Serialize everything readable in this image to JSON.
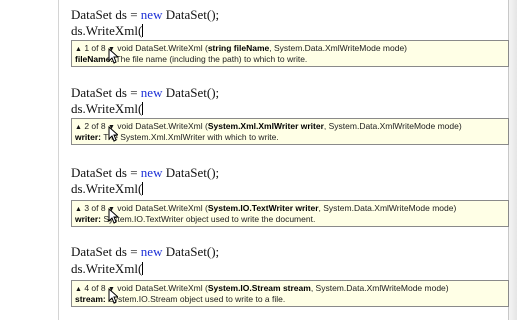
{
  "blocks": [
    {
      "line1_a": "DataSet ds = ",
      "line1_kw": "new",
      "line1_b": " DataSet();",
      "line2": "ds.WriteXml(",
      "tip": {
        "counter": "1 of 8",
        "sig_prefix": "void DataSet.WriteXml (",
        "param_bold": "string fileName",
        "sig_suffix": ", System.Data.XmlWriteMode mode)",
        "param_name": "fileName:",
        "param_desc": " The file name (including the path) to which to write."
      }
    },
    {
      "line1_a": "DataSet ds = ",
      "line1_kw": "new",
      "line1_b": " DataSet();",
      "line2": "ds.WriteXml(",
      "tip": {
        "counter": "2 of 8",
        "sig_prefix": "void DataSet.WriteXml (",
        "param_bold": "System.Xml.XmlWriter writer",
        "sig_suffix": ", System.Data.XmlWriteMode mode)",
        "param_name": "writer:",
        "param_desc": " The System.Xml.XmlWriter with which to write."
      }
    },
    {
      "line1_a": "DataSet ds = ",
      "line1_kw": "new",
      "line1_b": " DataSet();",
      "line2": "ds.WriteXml(",
      "tip": {
        "counter": "3 of 8",
        "sig_prefix": "void DataSet.WriteXml (",
        "param_bold": "System.IO.TextWriter writer",
        "sig_suffix": ", System.Data.XmlWriteMode mode)",
        "param_name": "writer:",
        "param_desc": " System.IO.TextWriter object used to write the document."
      }
    },
    {
      "line1_a": "DataSet ds = ",
      "line1_kw": "new",
      "line1_b": " DataSet();",
      "line2": "ds.WriteXml(",
      "tip": {
        "counter": "4 of 8",
        "sig_prefix": "void DataSet.WriteXml (",
        "param_bold": "System.IO.Stream stream",
        "sig_suffix": ", System.Data.XmlWriteMode mode)",
        "param_name": "stream:",
        "param_desc": " System.IO.Stream object used to write to a file."
      }
    }
  ],
  "icons": {
    "up": "up-arrow-icon",
    "down": "down-arrow-icon",
    "cursor": "mouse-pointer-icon"
  }
}
